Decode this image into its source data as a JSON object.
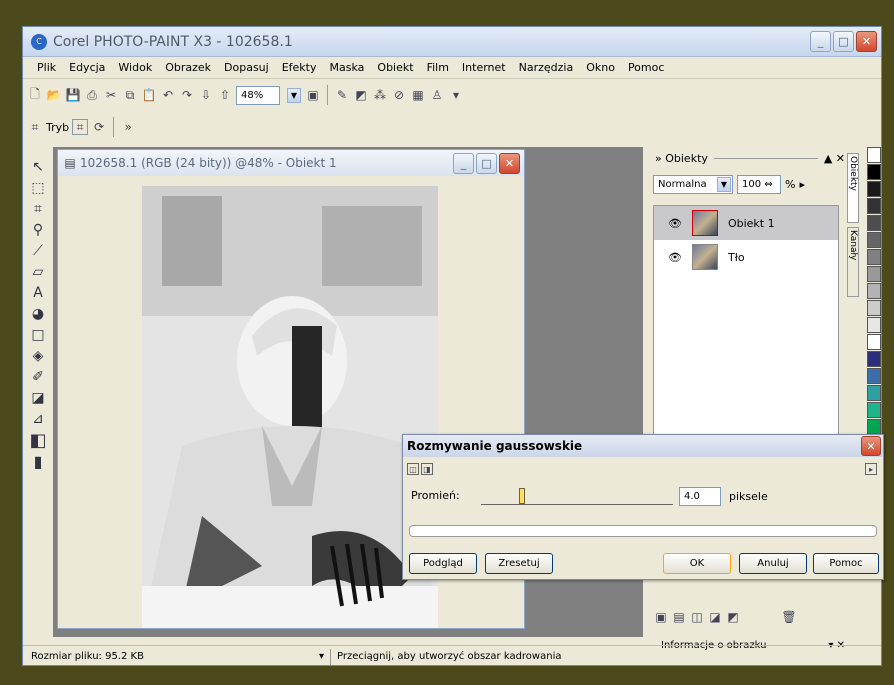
{
  "app": {
    "title": "Corel PHOTO-PAINT X3 - 102658.1",
    "logo_text": "C"
  },
  "menu": [
    "Plik",
    "Edycja",
    "Widok",
    "Obrazek",
    "Dopasuj",
    "Efekty",
    "Maska",
    "Obiekt",
    "Film",
    "Internet",
    "Narzędzia",
    "Okno",
    "Pomoc"
  ],
  "toolbar": {
    "zoom_value": "48%"
  },
  "propbar": {
    "mode_label": "Tryb"
  },
  "document": {
    "title": "102658.1 (RGB (24 bity)) @48% - Obiekt 1"
  },
  "objects_panel": {
    "header": "Obiekty",
    "blend_mode": "Normalna",
    "opacity": "100",
    "opacity_unit": "%",
    "layers": [
      {
        "name": "Obiekt 1",
        "selected": true
      },
      {
        "name": "Tło",
        "selected": false
      }
    ],
    "info_header": "Informacje o obrazku"
  },
  "side_tabs": [
    "Obiekty",
    "Kanały"
  ],
  "dialog": {
    "title": "Rozmywanie gaussowskie",
    "radius_label": "Promień:",
    "radius_value": "4.0",
    "radius_unit": "piksele",
    "preview_button": "Podgląd",
    "reset_button": "Zresetuj",
    "ok_button": "OK",
    "cancel_button": "Anuluj",
    "help_button": "Pomoc"
  },
  "status": {
    "file_size": "Rozmiar pliku: 95.2 KB",
    "hint": "Przeciągnij, aby utworzyć obszar kadrowania"
  },
  "colors": {
    "swatches": [
      "#ffffff",
      "#000000",
      "#1a1a1a",
      "#333333",
      "#4d4d4d",
      "#666666",
      "#808080",
      "#999999",
      "#b3b3b3",
      "#cccccc",
      "#e6e6e6",
      "#ffffff",
      "#2b2f7a",
      "#3c6ea8",
      "#2fa0a0",
      "#1eb58a",
      "#00a651",
      "#8dc63f",
      "#c0c0c0",
      "#a0a0c0",
      "#8080b0"
    ]
  }
}
